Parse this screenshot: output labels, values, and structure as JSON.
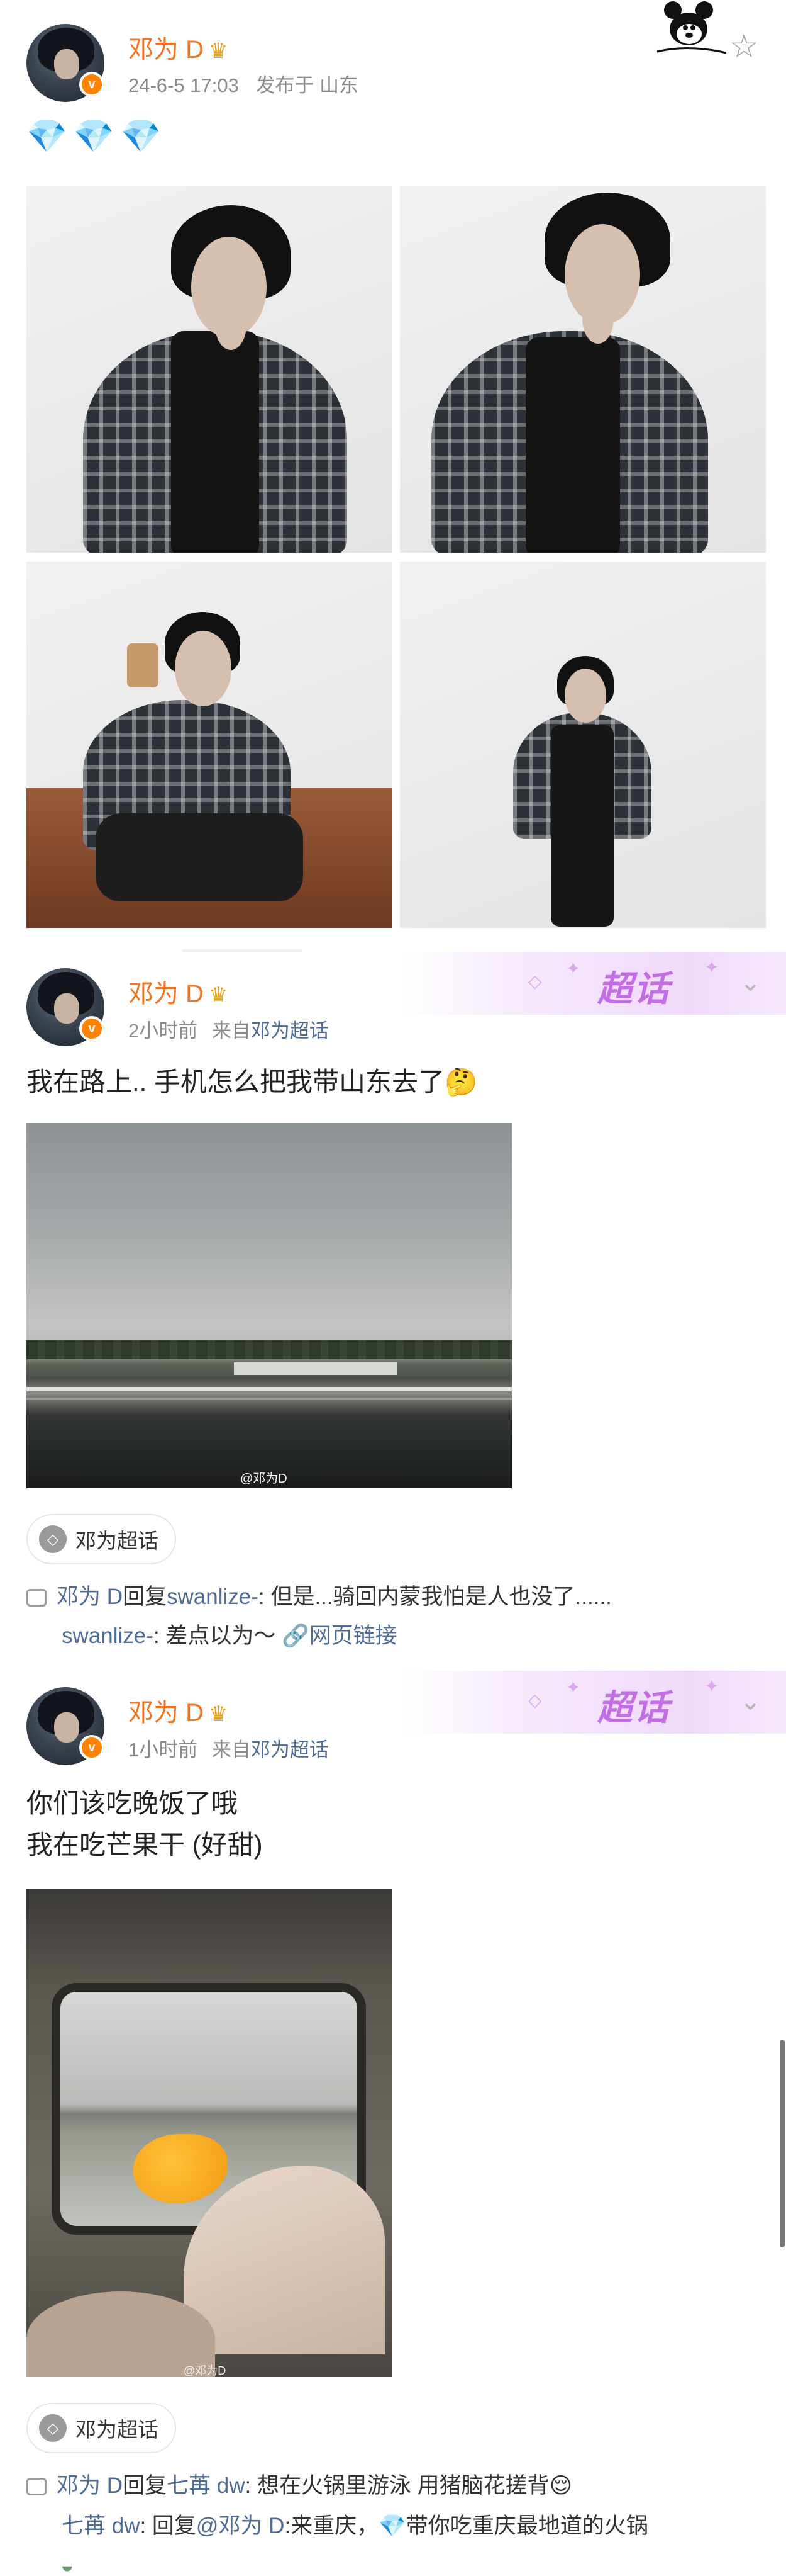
{
  "post1": {
    "username": "邓为 D",
    "date": "24-6-5 17:03",
    "location": "发布于 山东",
    "gems": "💎💎💎"
  },
  "post2": {
    "username": "邓为 D",
    "time": "2小时前",
    "source_prefix": "来自",
    "source": "邓为超话",
    "banner": "超话",
    "text": "我在路上.. 手机怎么把我带山东去了🤔",
    "watermark": "@邓为D",
    "tag": "邓为超话",
    "comments": [
      {
        "user": "邓为 D",
        "action": "回复",
        "target": "swanlize-",
        "text": ": 但是...骑回内蒙我怕是人也没了......"
      },
      {
        "user": "swanlize-",
        "text": ": 差点以为～",
        "link": "网页链接"
      }
    ]
  },
  "post3": {
    "username": "邓为 D",
    "time": "1小时前",
    "source_prefix": "来自",
    "source": "邓为超话",
    "banner": "超话",
    "text_line1": "你们该吃晚饭了哦",
    "text_line2": "我在吃芒果干 (好甜)",
    "watermark": "@邓为D",
    "tag": "邓为超话",
    "comments": [
      {
        "user": "邓为 D",
        "action": "回复",
        "target": "七苒 dw",
        "text": ": 想在火锅里游泳 用猪脑花搓背😌"
      },
      {
        "user": "七苒 dw",
        "text_a": ": 回复",
        "mention": "@邓为 D",
        "text_b": ":来重庆，💎带你吃重庆最地道的火锅"
      }
    ]
  },
  "colors": {
    "username": "#f5731f",
    "link": "#4d6b95",
    "superTopic": "#c46ee6"
  }
}
